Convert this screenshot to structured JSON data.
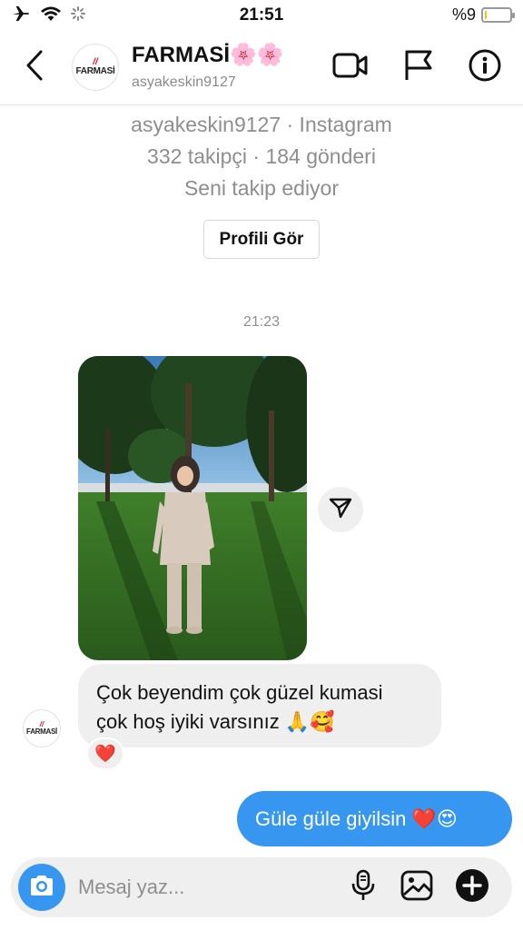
{
  "status_bar": {
    "time": "21:51",
    "battery_text": "%9",
    "battery_level": 0.09,
    "icons": [
      "airplane-icon",
      "wifi-icon",
      "activity-spinner-icon",
      "battery-icon"
    ]
  },
  "header": {
    "avatar_brand": "FARMASİ",
    "title": "FARMASİ🌸🌸",
    "username": "asyakeskin9127",
    "icons": [
      "back-chevron-icon",
      "video-call-icon",
      "flag-icon",
      "info-icon"
    ]
  },
  "profile": {
    "line1": "asyakeskin9127 · Instagram",
    "line2": "332 takipçi · 184 gönderi",
    "line3": "Seni takip ediyor",
    "button": "Profili Gör"
  },
  "chat": {
    "timestamp": "21:23",
    "incoming": {
      "line1": "Çok beyendim çok güzel kumasi",
      "line2": "çok hoş iyiki varsınız 🙏🥰",
      "reaction": "❤️"
    },
    "outgoing": {
      "text": "Güle güle giyilsin ❤️😍"
    }
  },
  "composer": {
    "placeholder": "Mesaj yaz...",
    "icons": [
      "camera-icon",
      "microphone-icon",
      "gallery-icon",
      "add-icon"
    ]
  },
  "colors": {
    "accent_blue": "#3797f0",
    "bubble_gray": "#efefef",
    "secondary_text": "#8e8e8e",
    "battery_yellow": "#f2c200",
    "heart_red": "#e0162b"
  }
}
